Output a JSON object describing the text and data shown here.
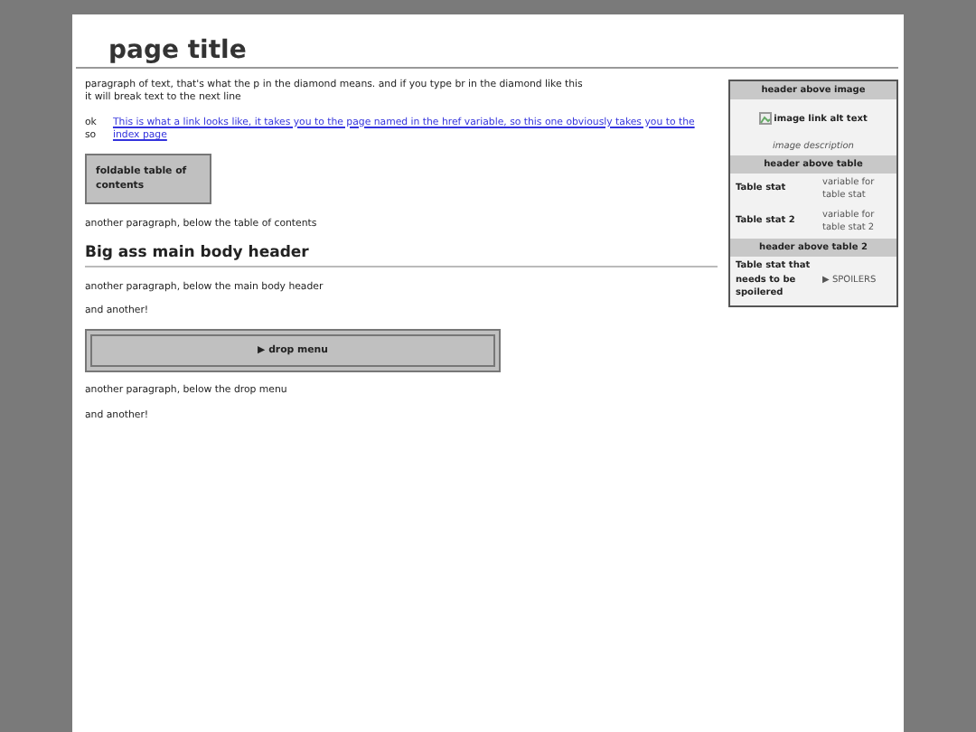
{
  "page_title": "page title",
  "infobox": {
    "image_header": "header above image",
    "image_alt": "image link alt text",
    "image_description": "image description",
    "table_header": "header above table",
    "stats": [
      {
        "label": "Table stat",
        "value": "variable for table stat"
      },
      {
        "label": "Table stat 2",
        "value": "variable for table stat 2"
      }
    ],
    "table2_header": "header above table 2",
    "spoiler_stat": {
      "label": "Table stat that needs to be spoilered",
      "marker": "▶",
      "summary": "SPOILERS",
      "expanded": false
    }
  },
  "content": [
    {
      "kind": "paragraph",
      "lines": [
        "paragraph of text, that's what the p in the diamond means. and if you type br in the diamond like this",
        "it will break text to the next line"
      ]
    },
    {
      "kind": "link_paragraph",
      "prefix": "ok so",
      "link": "This is what a link looks like, it takes you to the page named in the href variable, so this one obviously takes you to the index page"
    },
    {
      "kind": "toc",
      "label": "foldable table of contents"
    },
    {
      "kind": "paragraph",
      "lines": [
        "another paragraph, below the table of contents"
      ]
    },
    {
      "kind": "heading",
      "text": "Big ass main body header"
    },
    {
      "kind": "paragraph",
      "lines": [
        "another paragraph, below the main body header"
      ]
    },
    {
      "kind": "paragraph",
      "lines": [
        "and another!"
      ]
    },
    {
      "kind": "dropdown",
      "marker": "▶",
      "label": "drop menu",
      "expanded": false
    },
    {
      "kind": "paragraph",
      "lines": [
        "another paragraph, below the drop menu"
      ]
    },
    {
      "kind": "paragraph",
      "lines": [
        "and another!"
      ]
    }
  ]
}
